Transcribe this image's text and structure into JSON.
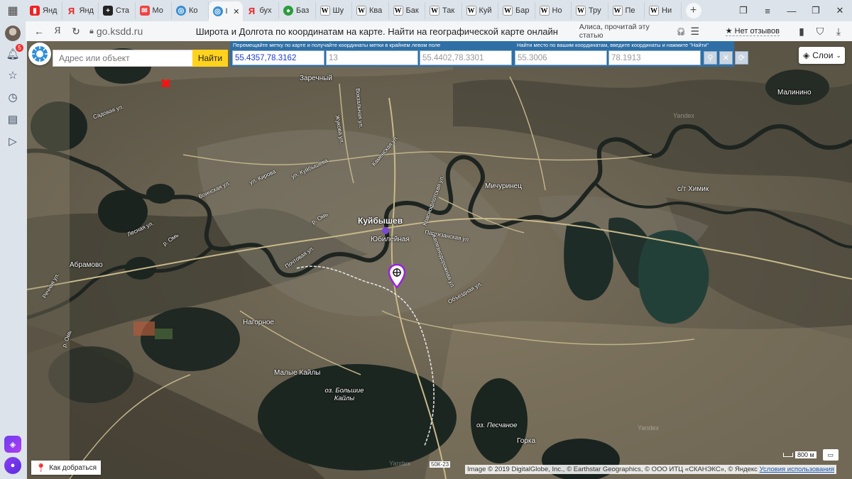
{
  "browser": {
    "tabs": [
      {
        "icon": "yandex-bookmark-icon",
        "label": "Янд"
      },
      {
        "icon": "yandex-icon",
        "label": "Янд"
      },
      {
        "icon": "statistics-icon",
        "label": "Ста"
      },
      {
        "icon": "mail-icon",
        "label": "Мо"
      },
      {
        "icon": "globe-icon",
        "label": "Ко"
      },
      {
        "icon": "globe-icon",
        "label": "I",
        "active": true
      },
      {
        "icon": "yandex-icon",
        "label": "бух"
      },
      {
        "icon": "bazaar-icon",
        "label": "Баз"
      },
      {
        "icon": "wikipedia-icon",
        "label": "Шу"
      },
      {
        "icon": "wikipedia-icon",
        "label": "Ква"
      },
      {
        "icon": "wikipedia-icon",
        "label": "Бак"
      },
      {
        "icon": "wikipedia-icon",
        "label": "Так"
      },
      {
        "icon": "wikipedia-icon",
        "label": "Куй"
      },
      {
        "icon": "wikipedia-icon",
        "label": "Бар"
      },
      {
        "icon": "wikipedia-icon",
        "label": "Но"
      },
      {
        "icon": "wikipedia-icon",
        "label": "Тру"
      },
      {
        "icon": "wikipedia-icon",
        "label": "Пе"
      },
      {
        "icon": "wikipedia-icon",
        "label": "Ни"
      }
    ],
    "url": "go.ksdd.ru",
    "page_title": "Широта и Долгота по координатам на карте. Найти на географической карте онлайн",
    "alice_read_label": "Алиса, прочитай эту статью",
    "reviews_label": "★ Нет отзывов",
    "notification_count": "5"
  },
  "map": {
    "search": {
      "placeholder": "Адрес или объект",
      "button": "Найти"
    },
    "coords_panel": {
      "move_hint": "Перемещайте метку по карте и получайте координаты метки в крайнем левом поле",
      "find_hint": "Найти место по вашим координатам, введите координаты и нажмите \"Найти\"",
      "marker_coords": "55.4357,78.3162",
      "zoom": "13",
      "center_coords": "55.4402,78.3301",
      "lat": "55.3006",
      "lon": "78.1913"
    },
    "layers_button": "Слои",
    "route_button": "Как добраться",
    "scale_label": "800 м",
    "copyright": "Image © 2019 DigitalGlobe, Inc., © Earthstar Geographics, © ООО ИТЦ «СКАНЭКС», © Яндекс",
    "terms_link": "Условия использования",
    "labels": {
      "kuybyshev": "Куйбышев",
      "yubileynaya": "Юбилейная",
      "zarechny": "Заречный",
      "malinino": "Малинино",
      "michurinets": "Мичуринец",
      "khimik": "с/т Химик",
      "abramovo": "Абрамово",
      "nagornoe": "Нагорное",
      "malye_kayly": "Малые Кайлы",
      "lake_bolshie": "оз. Большие Кайлы",
      "lake_peschanoe": "оз. Песчаное",
      "gorka": "Горка",
      "road_50k": "50К-23",
      "river_om1": "р. Омь",
      "river_om2": "р. Омь",
      "river_om3": "р. Омь",
      "st_voinskaya": "Воинская ул.",
      "st_lesnaya": "Лесная ул.",
      "st_rechnaya": "Речная ул.",
      "st_pochtovaya": "Почтовая ул.",
      "st_kirova": "ул. Кирова",
      "st_kuybysheva": "ул. Куйбышева",
      "st_zhukova": "Жукова ул.",
      "st_kamenskaya": "Каменская ул.",
      "st_partizanskaya": "Партизанская ул.",
      "st_krasnoflotskaya": "Краснофлотская ул.",
      "st_zheleznodorozhnaya": "Железнодорожная ул.",
      "st_ob_ezdnaya": "Объездная ул.",
      "st_vokzalnaya": "Вокзальная ул.",
      "st_sadovaya": "Садовая ул.",
      "watermark1": "Yandex",
      "watermark2": "Yandex",
      "watermark3": "Yandex"
    }
  }
}
